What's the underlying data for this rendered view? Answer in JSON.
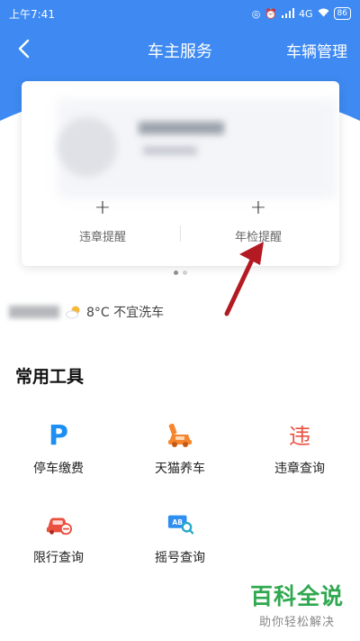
{
  "status_bar": {
    "time": "上午7:41",
    "network": "4G",
    "battery": "86"
  },
  "header": {
    "title": "车主服务",
    "right_label": "车辆管理"
  },
  "card": {
    "actions": [
      {
        "label": "违章提醒"
      },
      {
        "label": "年检提醒"
      }
    ]
  },
  "weather": {
    "text": "8°C 不宜洗车"
  },
  "tools": {
    "title": "常用工具",
    "items": [
      {
        "label": "停车缴费",
        "icon": "parking-icon"
      },
      {
        "label": "天猫养车",
        "icon": "car-repair-icon"
      },
      {
        "label": "违章查询",
        "icon": "violation-icon"
      },
      {
        "label": "限行查询",
        "icon": "restricted-car-icon"
      },
      {
        "label": "摇号查询",
        "icon": "lottery-search-icon"
      }
    ]
  },
  "watermark": {
    "main": "百科全说",
    "sub": "助你轻松解决"
  },
  "colors": {
    "primary": "#3e8af2",
    "parking": "#1c8ff2",
    "orange": "#f5862f",
    "red": "#ea5040",
    "arrow": "#b31a22",
    "watermark": "#2fa84f"
  }
}
